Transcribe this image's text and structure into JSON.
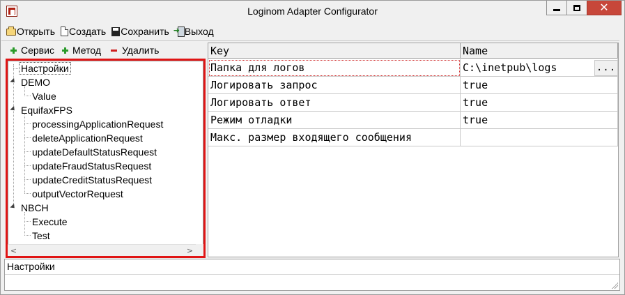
{
  "window": {
    "title": "Loginom Adapter Configurator",
    "close_glyph": "✕"
  },
  "menu": {
    "open": "Открыть",
    "create": "Создать",
    "save": "Сохранить",
    "exit": "Выход"
  },
  "left_toolbar": {
    "service": "Сервис",
    "method": "Метод",
    "delete": "Удалить"
  },
  "tree": {
    "settings": "Настройки",
    "demo": "DEMO",
    "demo_value": "Value",
    "equifax": "EquifaxFPS",
    "equifax_children": [
      "processingApplicationRequest",
      "deleteApplicationRequest",
      "updateDefaultStatusRequest",
      "updateFraudStatusRequest",
      "updateCreditStatusRequest",
      "outputVectorRequest"
    ],
    "nbch": "NBCH",
    "nbch_children": [
      "Execute",
      "Test"
    ],
    "scroll_left": "<",
    "scroll_right": ">"
  },
  "grid": {
    "columns": [
      "Key",
      "Name"
    ],
    "rows": [
      {
        "key": "Папка для логов",
        "value": "C:\\inetpub\\logs"
      },
      {
        "key": "Логировать запрос",
        "value": "true"
      },
      {
        "key": "Логировать ответ",
        "value": "true"
      },
      {
        "key": "Режим отладки",
        "value": "true"
      },
      {
        "key": "Макс. размер входящего сообщения",
        "value": ""
      }
    ],
    "ellipsis": "..."
  },
  "description": {
    "text": "Настройки"
  },
  "colors": {
    "highlight_border": "#e01515",
    "add_icon": "#2a9a2a",
    "delete_icon": "#cf1f1f",
    "close_button": "#c7473a"
  },
  "icons": [
    "app-icon",
    "open-folder-icon",
    "new-document-icon",
    "save-disk-icon",
    "exit-door-icon",
    "plus-icon",
    "minus-icon"
  ]
}
